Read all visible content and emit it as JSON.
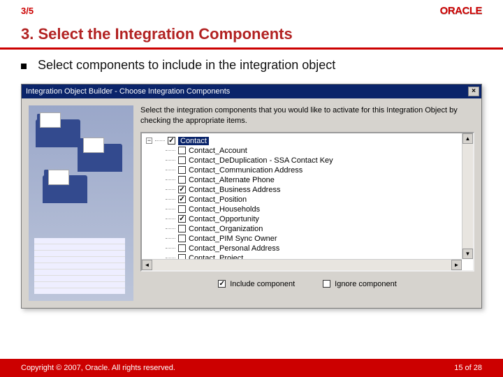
{
  "header": {
    "slide_count": "3/5",
    "logo_text": "ORACLE"
  },
  "title": "3. Select the Integration Components",
  "bullet": "Select components to include in the integration object",
  "dialog": {
    "title": "Integration Object Builder - Choose Integration Components",
    "instruction": "Select the integration components that you would like to activate for this Integration Object by checking the appropriate items.",
    "root": {
      "label": "Contact",
      "checked": true,
      "selected": true
    },
    "items": [
      {
        "label": "Contact_Account",
        "checked": false
      },
      {
        "label": "Contact_DeDuplication - SSA Contact Key",
        "checked": false
      },
      {
        "label": "Contact_Communication Address",
        "checked": false
      },
      {
        "label": "Contact_Alternate Phone",
        "checked": false
      },
      {
        "label": "Contact_Business Address",
        "checked": true
      },
      {
        "label": "Contact_Position",
        "checked": true
      },
      {
        "label": "Contact_Households",
        "checked": false
      },
      {
        "label": "Contact_Opportunity",
        "checked": true
      },
      {
        "label": "Contact_Organization",
        "checked": false
      },
      {
        "label": "Contact_PIM Sync Owner",
        "checked": false
      },
      {
        "label": "Contact_Personal Address",
        "checked": false
      },
      {
        "label": "Contact_Project",
        "checked": false
      }
    ],
    "legend_include": "Include component",
    "legend_ignore": "Ignore component"
  },
  "footer": {
    "copyright": "Copyright © 2007, Oracle. All rights reserved.",
    "page_current": "15",
    "page_sep": " of ",
    "page_total": "28"
  }
}
